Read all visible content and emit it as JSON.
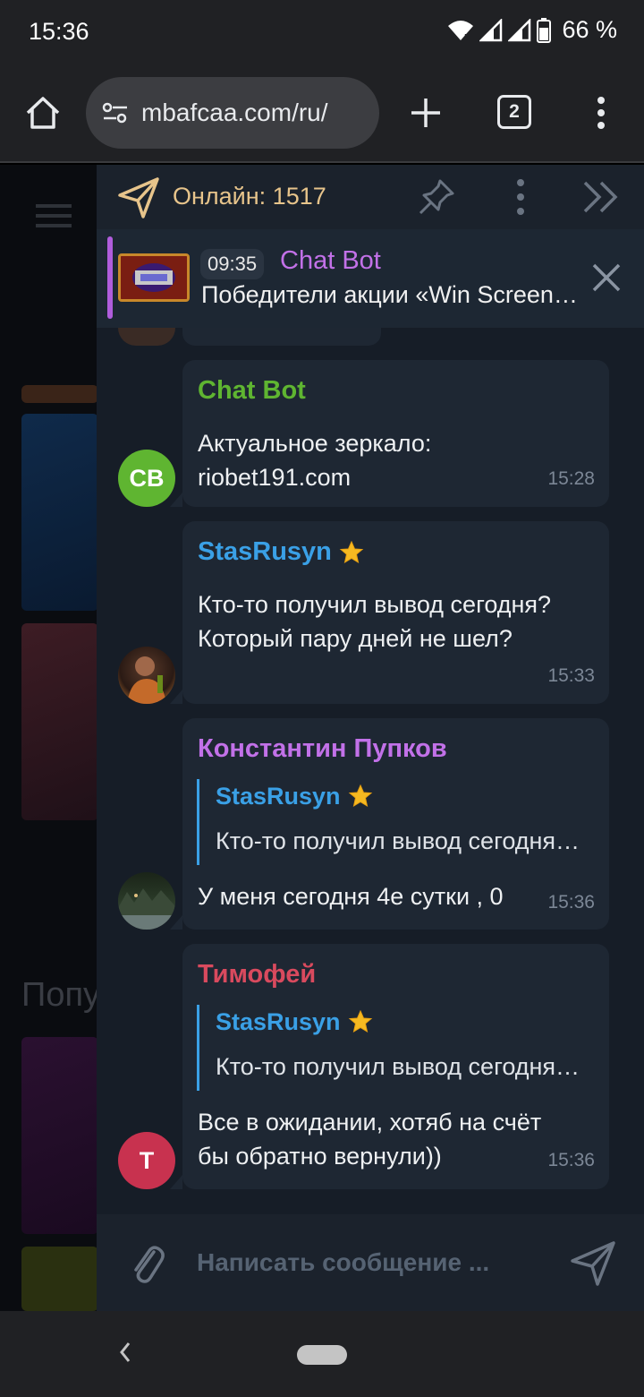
{
  "status": {
    "time": "15:36",
    "battery": "66 %"
  },
  "browser": {
    "url": "mbafcaa.com/ru/",
    "tab_count": "2"
  },
  "background": {
    "popular_label": "Попу"
  },
  "chat": {
    "online": "Онлайн: 1517",
    "pinned": {
      "time": "09:35",
      "author": "Chat Bot",
      "text": "Победители акции «Win Screen…"
    },
    "messages": [
      {
        "author": "Chat Bot",
        "author_color": "#5fb531",
        "text_lines": [
          "Актуальное зеркало:",
          "riobet191.com"
        ],
        "time": "15:28",
        "avatar_initials": "CB",
        "avatar_color": "#5fb531"
      },
      {
        "author": "StasRusyn",
        "author_color": "#3aa0e6",
        "text_lines": [
          "Кто-то получил вывод сегодня?",
          "Который пару дней не шел?"
        ],
        "time": "15:33"
      },
      {
        "author": "Константин Пупков",
        "author_color": "#c271e8",
        "quote_author": "StasRusyn",
        "quote_text": "Кто-то получил вывод сегодня…",
        "text_lines": [
          "У меня сегодня 4е сутки , 0"
        ],
        "time": "15:36"
      },
      {
        "author": "Тимофей",
        "author_color": "#d94a5e",
        "quote_author": "StasRusyn",
        "quote_text": "Кто-то получил вывод сегодня…",
        "text_lines": [
          "Все в ожидании, хотяб на счёт",
          "бы обратно вернули))"
        ],
        "time": "15:36",
        "avatar_initials": "T",
        "avatar_color": "#c8324f"
      }
    ],
    "input_placeholder": "Написать сообщение ..."
  }
}
